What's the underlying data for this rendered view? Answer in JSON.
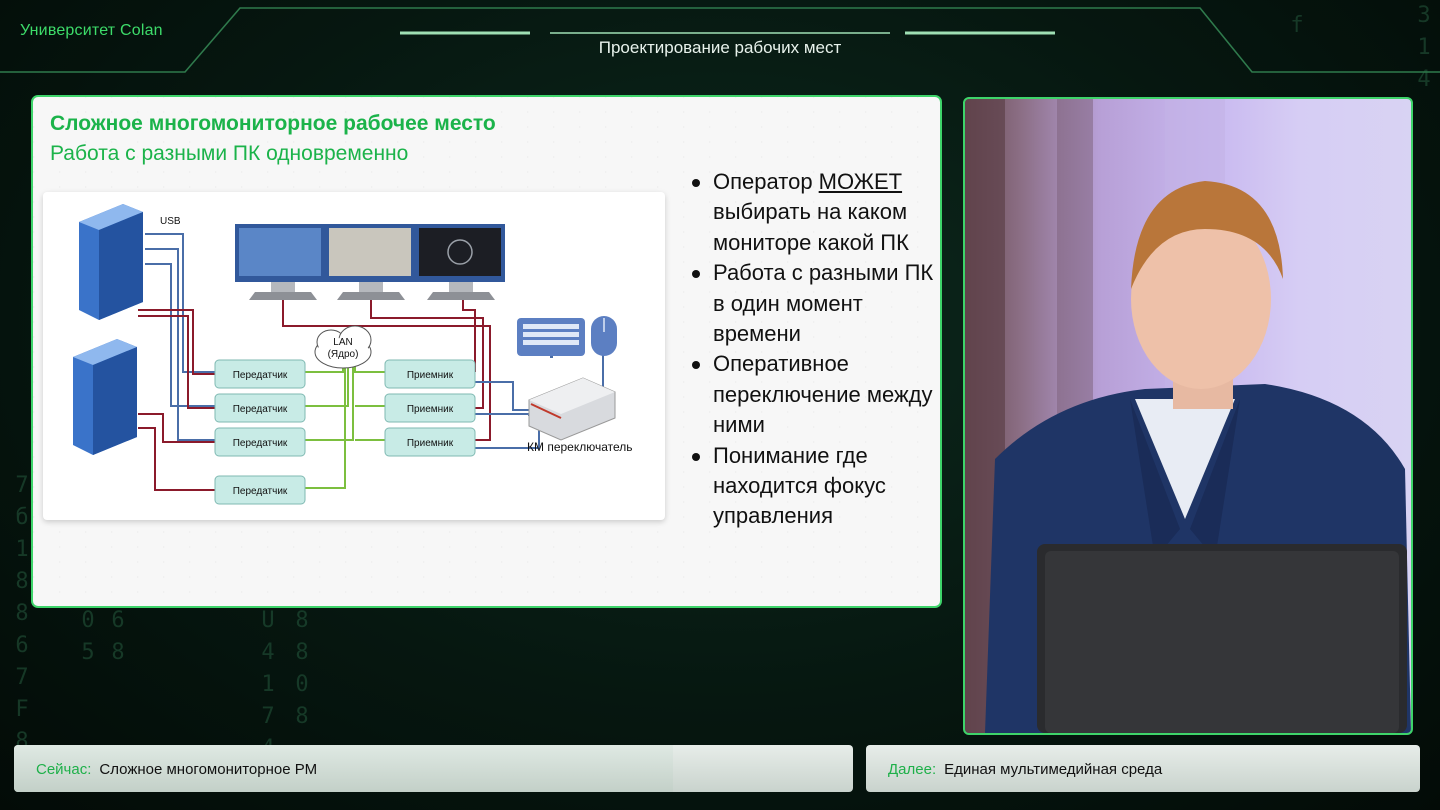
{
  "header": {
    "brand": "Университет Colan",
    "topic": "Проектирование рабочих мест"
  },
  "slide": {
    "title": "Сложное многомониторное рабочее место",
    "subtitle": "Работа с разными ПК одновременно",
    "bullets": [
      {
        "before": "Оператор ",
        "underlined": "МОЖЕТ",
        "after": " выбирать на каком мониторе какой ПК"
      },
      {
        "text": "Работа с разными ПК в один момент времени"
      },
      {
        "text": "Оперативное переключение между ними"
      },
      {
        "text": "Понимание где находится фокус управления"
      }
    ],
    "diagram": {
      "usb_label": "USB",
      "lan_label": "LAN",
      "core_label": "(Ядро)",
      "transmitters": [
        "Передатчик",
        "Передатчик",
        "Передатчик",
        "Передатчик"
      ],
      "receivers": [
        "Приемник",
        "Приемник",
        "Приемник"
      ],
      "km_label": "КМ переключатель"
    }
  },
  "footer": {
    "now_label": "Сейчас:",
    "now_value": "Сложное многомониторное РМ",
    "now_progress": 0.786,
    "next_label": "Далее:",
    "next_value": "Единая мультимедийная среда"
  },
  "colors": {
    "accent": "#3ed46a",
    "title_green": "#1bb34a",
    "cable_red": "#8b1a2b",
    "cable_blue": "#4a6ea8",
    "cable_green": "#7cbf3f"
  }
}
